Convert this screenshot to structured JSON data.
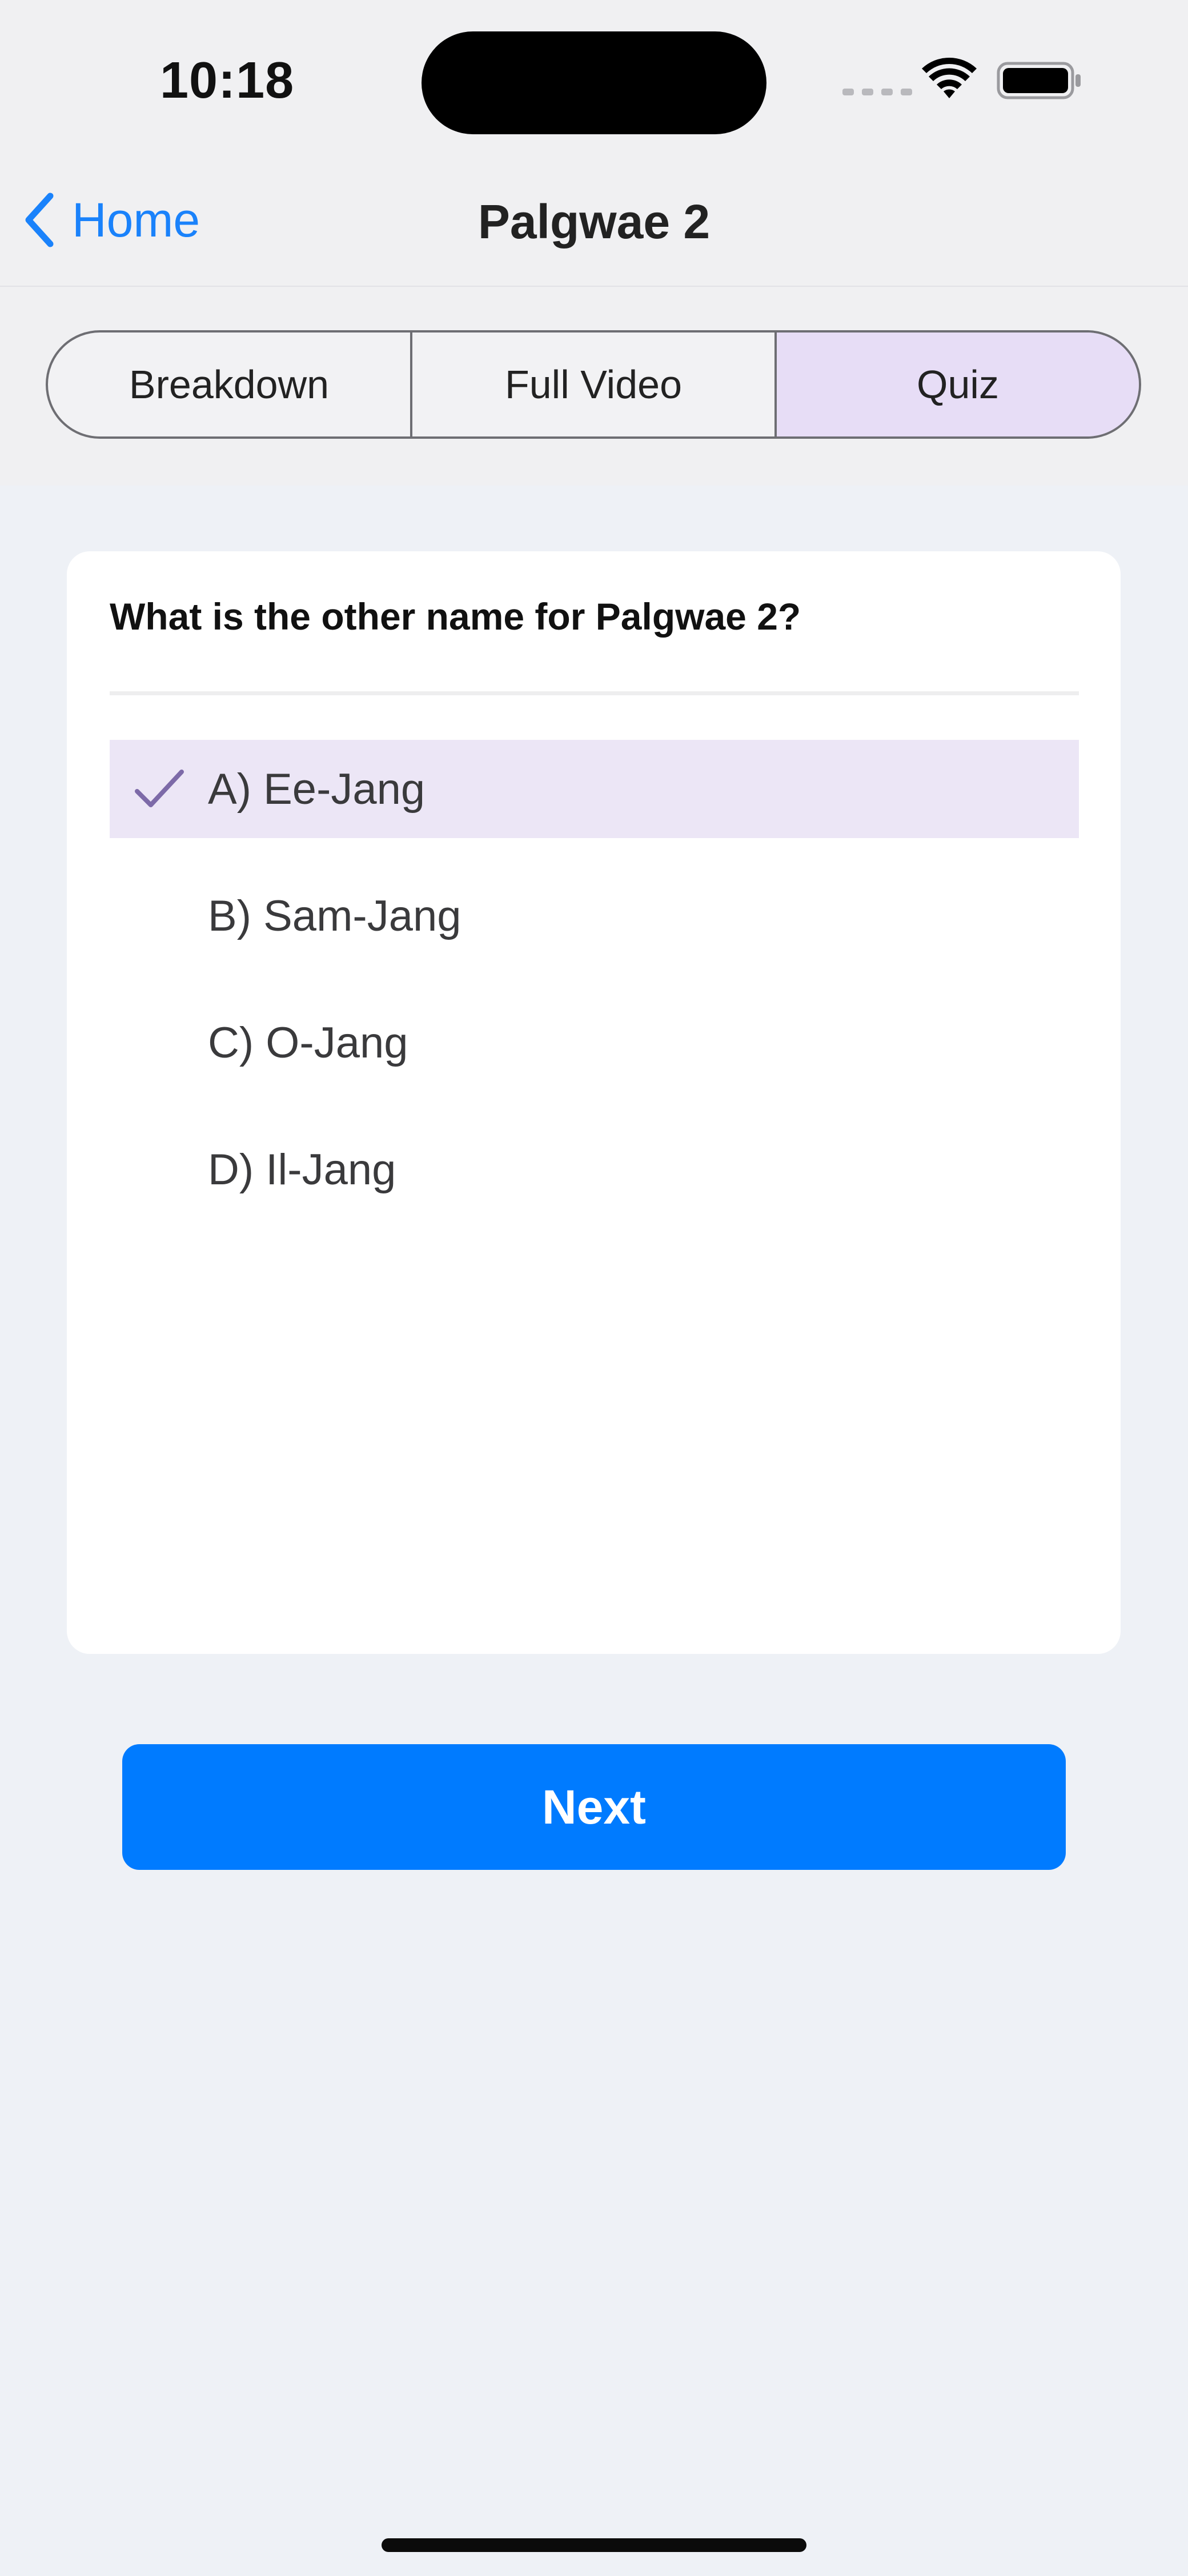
{
  "status_bar": {
    "time": "10:18",
    "icons": [
      "signal-dots-icon",
      "wifi-icon",
      "battery-icon"
    ]
  },
  "nav": {
    "back_label": "Home",
    "title": "Palgwae 2"
  },
  "tabs": [
    {
      "label": "Breakdown",
      "active": false
    },
    {
      "label": "Full Video",
      "active": false
    },
    {
      "label": "Quiz",
      "active": true
    }
  ],
  "quiz": {
    "question": "What is the other name for Palgwae 2?",
    "options": [
      {
        "label": "A) Ee-Jang",
        "selected": true
      },
      {
        "label": "B) Sam-Jang",
        "selected": false
      },
      {
        "label": "C) O-Jang",
        "selected": false
      },
      {
        "label": "D) Il-Jang",
        "selected": false
      }
    ]
  },
  "actions": {
    "next_label": "Next"
  },
  "colors": {
    "accent": "#007bff",
    "back_link": "#1a82fb",
    "selected_tab": "#e7ddf6",
    "selected_option": "#ece6f6",
    "check": "#7d6aa8",
    "background": "#eef1f6"
  }
}
